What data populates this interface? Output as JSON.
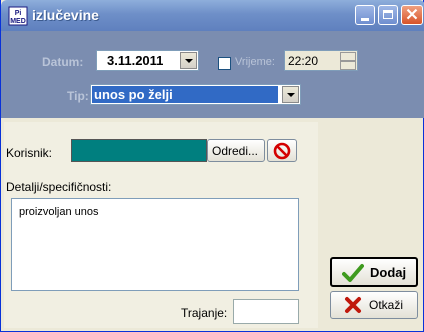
{
  "window": {
    "title": "izlučevine"
  },
  "top": {
    "datum_label": "Datum:",
    "datum_value": "3.11.2011",
    "vrijeme_label": "Vrijeme:",
    "vrijeme_value": "22:20",
    "tip_label": "Tip:",
    "tip_value": "unos po želji"
  },
  "form": {
    "korisnik_label": "Korisnik:",
    "korisnik_value": "",
    "odredi_label": "Odredi...",
    "detalji_label": "Detalji/specifičnosti:",
    "detalji_value": "proizvoljan unos",
    "trajanje_label": "Trajanje:",
    "trajanje_value": ""
  },
  "actions": {
    "dodaj_label": "Dodaj",
    "otkazi_label": "Otkaži"
  },
  "icons": {
    "app": "medical-app-icon",
    "checkmark": "checkmark-icon",
    "cancel": "x-icon",
    "prohibit": "no-entry-icon"
  },
  "colors": {
    "korisnik_field": "#007F7F",
    "band": "#7B8DB0"
  }
}
